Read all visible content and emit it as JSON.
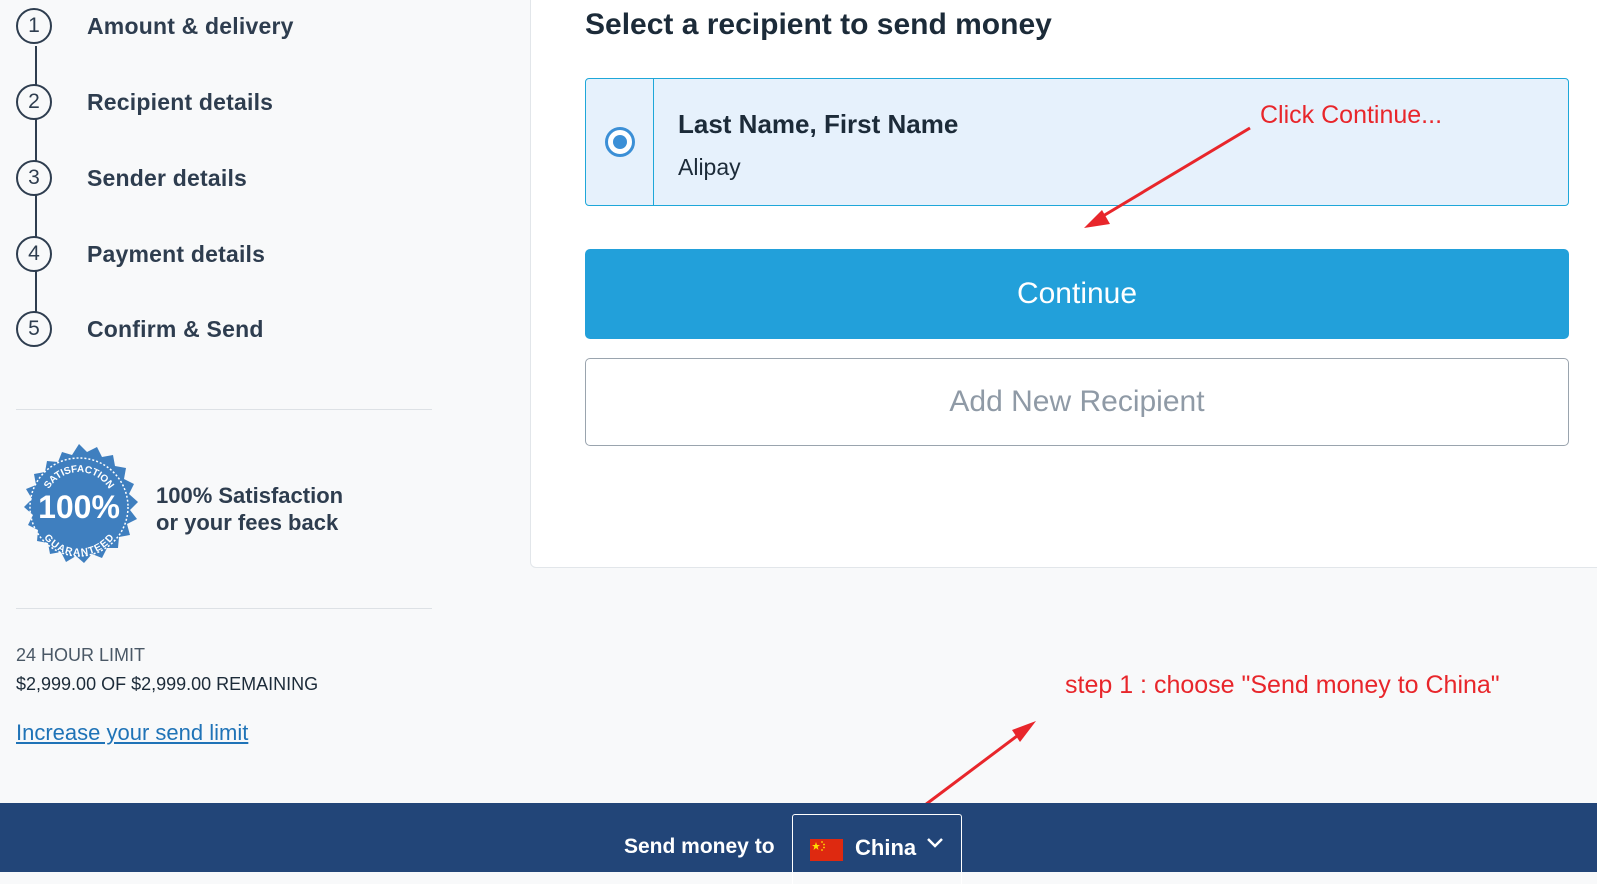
{
  "sidebar": {
    "steps": [
      {
        "number": "1",
        "label": "Amount & delivery"
      },
      {
        "number": "2",
        "label": "Recipient details"
      },
      {
        "number": "3",
        "label": "Sender details"
      },
      {
        "number": "4",
        "label": "Payment details"
      },
      {
        "number": "5",
        "label": "Confirm & Send"
      }
    ],
    "badge": {
      "top_text": "SATISFACTION",
      "percent": "100%",
      "bottom_text": "GUARANTEED",
      "line1": "100% Satisfaction",
      "line2": "or your fees back"
    },
    "limit": {
      "title": "24 HOUR LIMIT",
      "value": "$2,999.00 OF $2,999.00 REMAINING",
      "link": "Increase your send limit"
    }
  },
  "main": {
    "title": "Select a recipient to send money",
    "recipient": {
      "name": "Last Name, First Name",
      "method": "Alipay",
      "selected": true
    },
    "continue_label": "Continue",
    "add_recipient_label": "Add New Recipient"
  },
  "annotations": {
    "continue_note": "Click Continue...",
    "step_note": "step 1 : choose \"Send money to China\""
  },
  "footer": {
    "label": "Send money to",
    "country": "China",
    "flag_icon": "china-flag-icon"
  },
  "colors": {
    "primary": "#22a0da",
    "footer_bg": "#224578",
    "annotation": "#e8262b",
    "badge": "#3f7fbf"
  }
}
